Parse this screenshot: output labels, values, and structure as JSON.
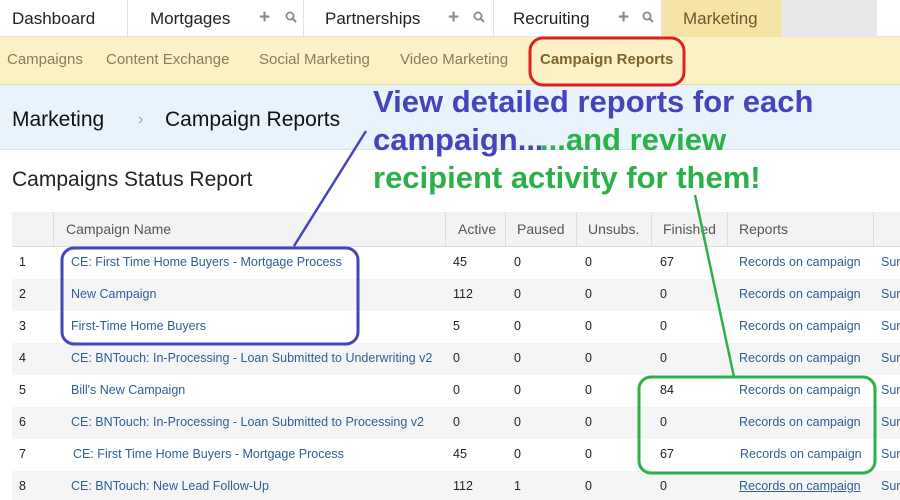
{
  "tabs": [
    {
      "label": "Dashboard"
    },
    {
      "label": "Mortgages"
    },
    {
      "label": "Partnerships"
    },
    {
      "label": "Recruiting"
    },
    {
      "label": "Marketing"
    }
  ],
  "icons": {
    "add": "plus-icon",
    "search": "search-icon",
    "separator": "chevron-right-icon"
  },
  "subnav": {
    "items": [
      "Campaigns",
      "Content Exchange",
      "Social Marketing",
      "Video Marketing",
      "Campaign Reports"
    ]
  },
  "breadcrumb": {
    "parent": "Marketing",
    "current": "Campaign Reports"
  },
  "page_title": "Campaigns Status Report",
  "table": {
    "headers": [
      "Campaign Name",
      "Active",
      "Paused",
      "Unsubs.",
      "Finished",
      "Reports"
    ],
    "rows": [
      {
        "num": "1",
        "name": "CE: First Time Home Buyers - Mortgage Process",
        "active": "45",
        "paused": "0",
        "unsubs": "0",
        "finished": "67",
        "report": "Records on campaign",
        "more": "Sur"
      },
      {
        "num": "2",
        "name": "New Campaign",
        "active": "112",
        "paused": "0",
        "unsubs": "0",
        "finished": "0",
        "report": "Records on campaign",
        "more": "Sur"
      },
      {
        "num": "3",
        "name": "First-Time Home Buyers",
        "active": "5",
        "paused": "0",
        "unsubs": "0",
        "finished": "0",
        "report": "Records on campaign",
        "more": "Sur"
      },
      {
        "num": "4",
        "name": "CE: BNTouch: In-Processing - Loan Submitted to Underwriting v2",
        "active": "0",
        "paused": "0",
        "unsubs": "0",
        "finished": "0",
        "report": "Records on campaign",
        "more": "Sur"
      },
      {
        "num": "5",
        "name": "Bill's New Campaign",
        "active": "0",
        "paused": "0",
        "unsubs": "0",
        "finished": "84",
        "report": "Records on campaign",
        "more": "Sur"
      },
      {
        "num": "6",
        "name": "CE: BNTouch: In-Processing - Loan Submitted to Processing v2",
        "active": "0",
        "paused": "0",
        "unsubs": "0",
        "finished": "0",
        "report": "Records on campaign",
        "more": "Sur"
      },
      {
        "num": "7",
        "name": "CE: First Time Home Buyers - Mortgage Process",
        "active": "45",
        "paused": "0",
        "unsubs": "0",
        "finished": "67",
        "report": "Records on campaign",
        "more": "Sur"
      },
      {
        "num": "8",
        "name": "CE: BNTouch: New Lead Follow-Up",
        "active": "112",
        "paused": "1",
        "unsubs": "0",
        "finished": "0",
        "report": "Records on campaign",
        "more": "Sur"
      }
    ]
  },
  "annotations": {
    "line1": "View detailed reports for each",
    "line2": "campaign...",
    "line3": "...and review",
    "line4": "recipient activity for them!",
    "blue_color": "#4444bb",
    "green_color": "#2bb04a",
    "highlight_color": "#e02020"
  }
}
